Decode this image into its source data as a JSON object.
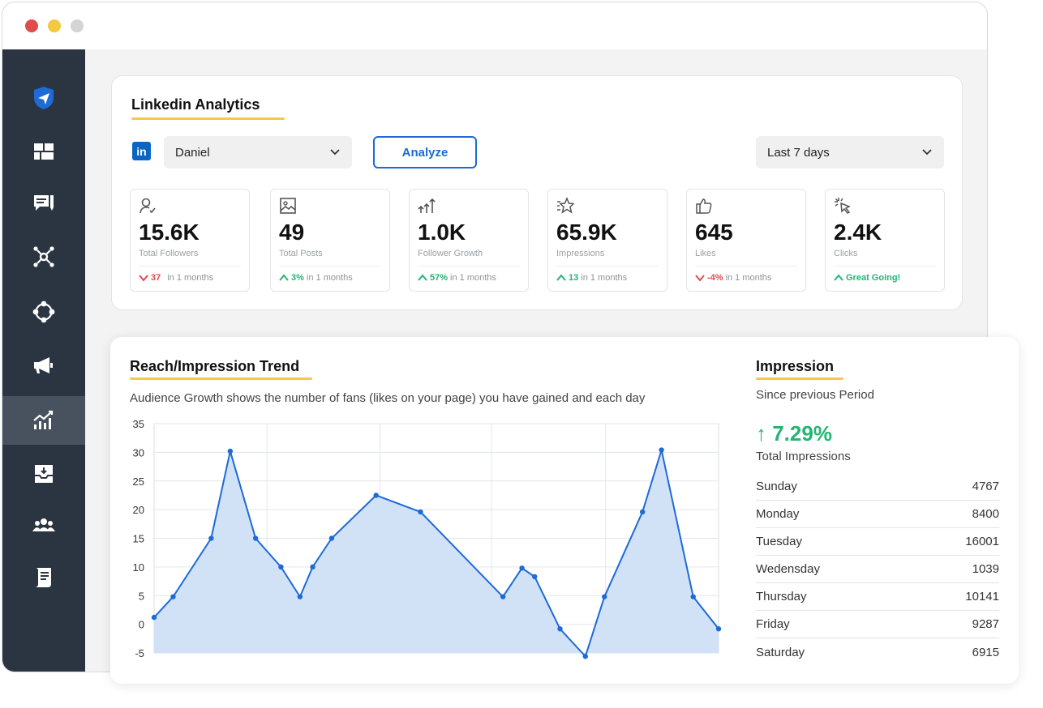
{
  "window": {
    "dots": [
      "#e04b4b",
      "#f5c842",
      "#d4d4d4"
    ]
  },
  "sidebar": {
    "items": [
      {
        "name": "send-icon"
      },
      {
        "name": "dashboard-icon"
      },
      {
        "name": "messages-icon"
      },
      {
        "name": "network-icon"
      },
      {
        "name": "connect-icon"
      },
      {
        "name": "megaphone-icon"
      },
      {
        "name": "analytics-icon",
        "active": true
      },
      {
        "name": "inbox-icon"
      },
      {
        "name": "team-icon"
      },
      {
        "name": "report-icon"
      }
    ]
  },
  "analytics": {
    "title": "Linkedin Analytics",
    "platform_logo": "in",
    "account": "Daniel",
    "analyze_label": "Analyze",
    "period": "Last 7 days",
    "stats": [
      {
        "icon": "user-check-icon",
        "value": "15.6K",
        "label": "Total Followers",
        "direction": "down",
        "change": "37",
        "suffix": "in 1 months"
      },
      {
        "icon": "image-icon",
        "value": "49",
        "label": "Total Posts",
        "direction": "up",
        "change": "3%",
        "suffix": "in 1 months"
      },
      {
        "icon": "growth-arrows-icon",
        "value": "1.0K",
        "label": "Follower Growth",
        "direction": "up",
        "change": "57%",
        "suffix": "in 1 months"
      },
      {
        "icon": "star-icon",
        "value": "65.9K",
        "label": "Impressions",
        "direction": "up",
        "change": "13",
        "suffix": "in 1 months"
      },
      {
        "icon": "thumbs-up-icon",
        "value": "645",
        "label": "Likes",
        "direction": "down",
        "change": "-4%",
        "suffix": "in 1 months"
      },
      {
        "icon": "cursor-click-icon",
        "value": "2.4K",
        "label": "Clicks",
        "direction": "up",
        "change": "Great Going!",
        "suffix": ""
      }
    ]
  },
  "trend": {
    "title": "Reach/Impression Trend",
    "description": "Audience Growth shows the number of fans (likes on your page) you have gained and each day"
  },
  "chart_data": {
    "type": "area",
    "title": "",
    "xlabel": "",
    "ylabel": "",
    "ylim": [
      -5,
      35
    ],
    "yticks": [
      35,
      30,
      25,
      20,
      15,
      10,
      5,
      0,
      -5
    ],
    "grid": true,
    "color": "#1e6ad6",
    "fill": "#cfe0f7",
    "x": [
      0,
      3,
      9,
      12,
      16,
      20,
      23,
      25,
      28,
      35,
      42,
      55,
      58,
      60,
      64,
      68,
      71,
      77,
      80,
      85,
      89
    ],
    "y": [
      1.2,
      4.8,
      15,
      30.2,
      15,
      10,
      4.8,
      10,
      15,
      22.5,
      19.6,
      4.8,
      9.8,
      8.3,
      -0.8,
      -5.6,
      4.8,
      19.6,
      30.4,
      4.8,
      -0.8
    ]
  },
  "impression": {
    "title": "Impression",
    "subtitle": "Since previous Period",
    "percent": "↑ 7.29%",
    "total_label": "Total Impressions",
    "rows": [
      {
        "day": "Sunday",
        "value": "4767"
      },
      {
        "day": "Monday",
        "value": "8400"
      },
      {
        "day": "Tuesday",
        "value": "16001"
      },
      {
        "day": "Wedensday",
        "value": "1039"
      },
      {
        "day": "Thursday",
        "value": "10141"
      },
      {
        "day": "Friday",
        "value": "9287"
      },
      {
        "day": "Saturday",
        "value": "6915"
      }
    ]
  }
}
